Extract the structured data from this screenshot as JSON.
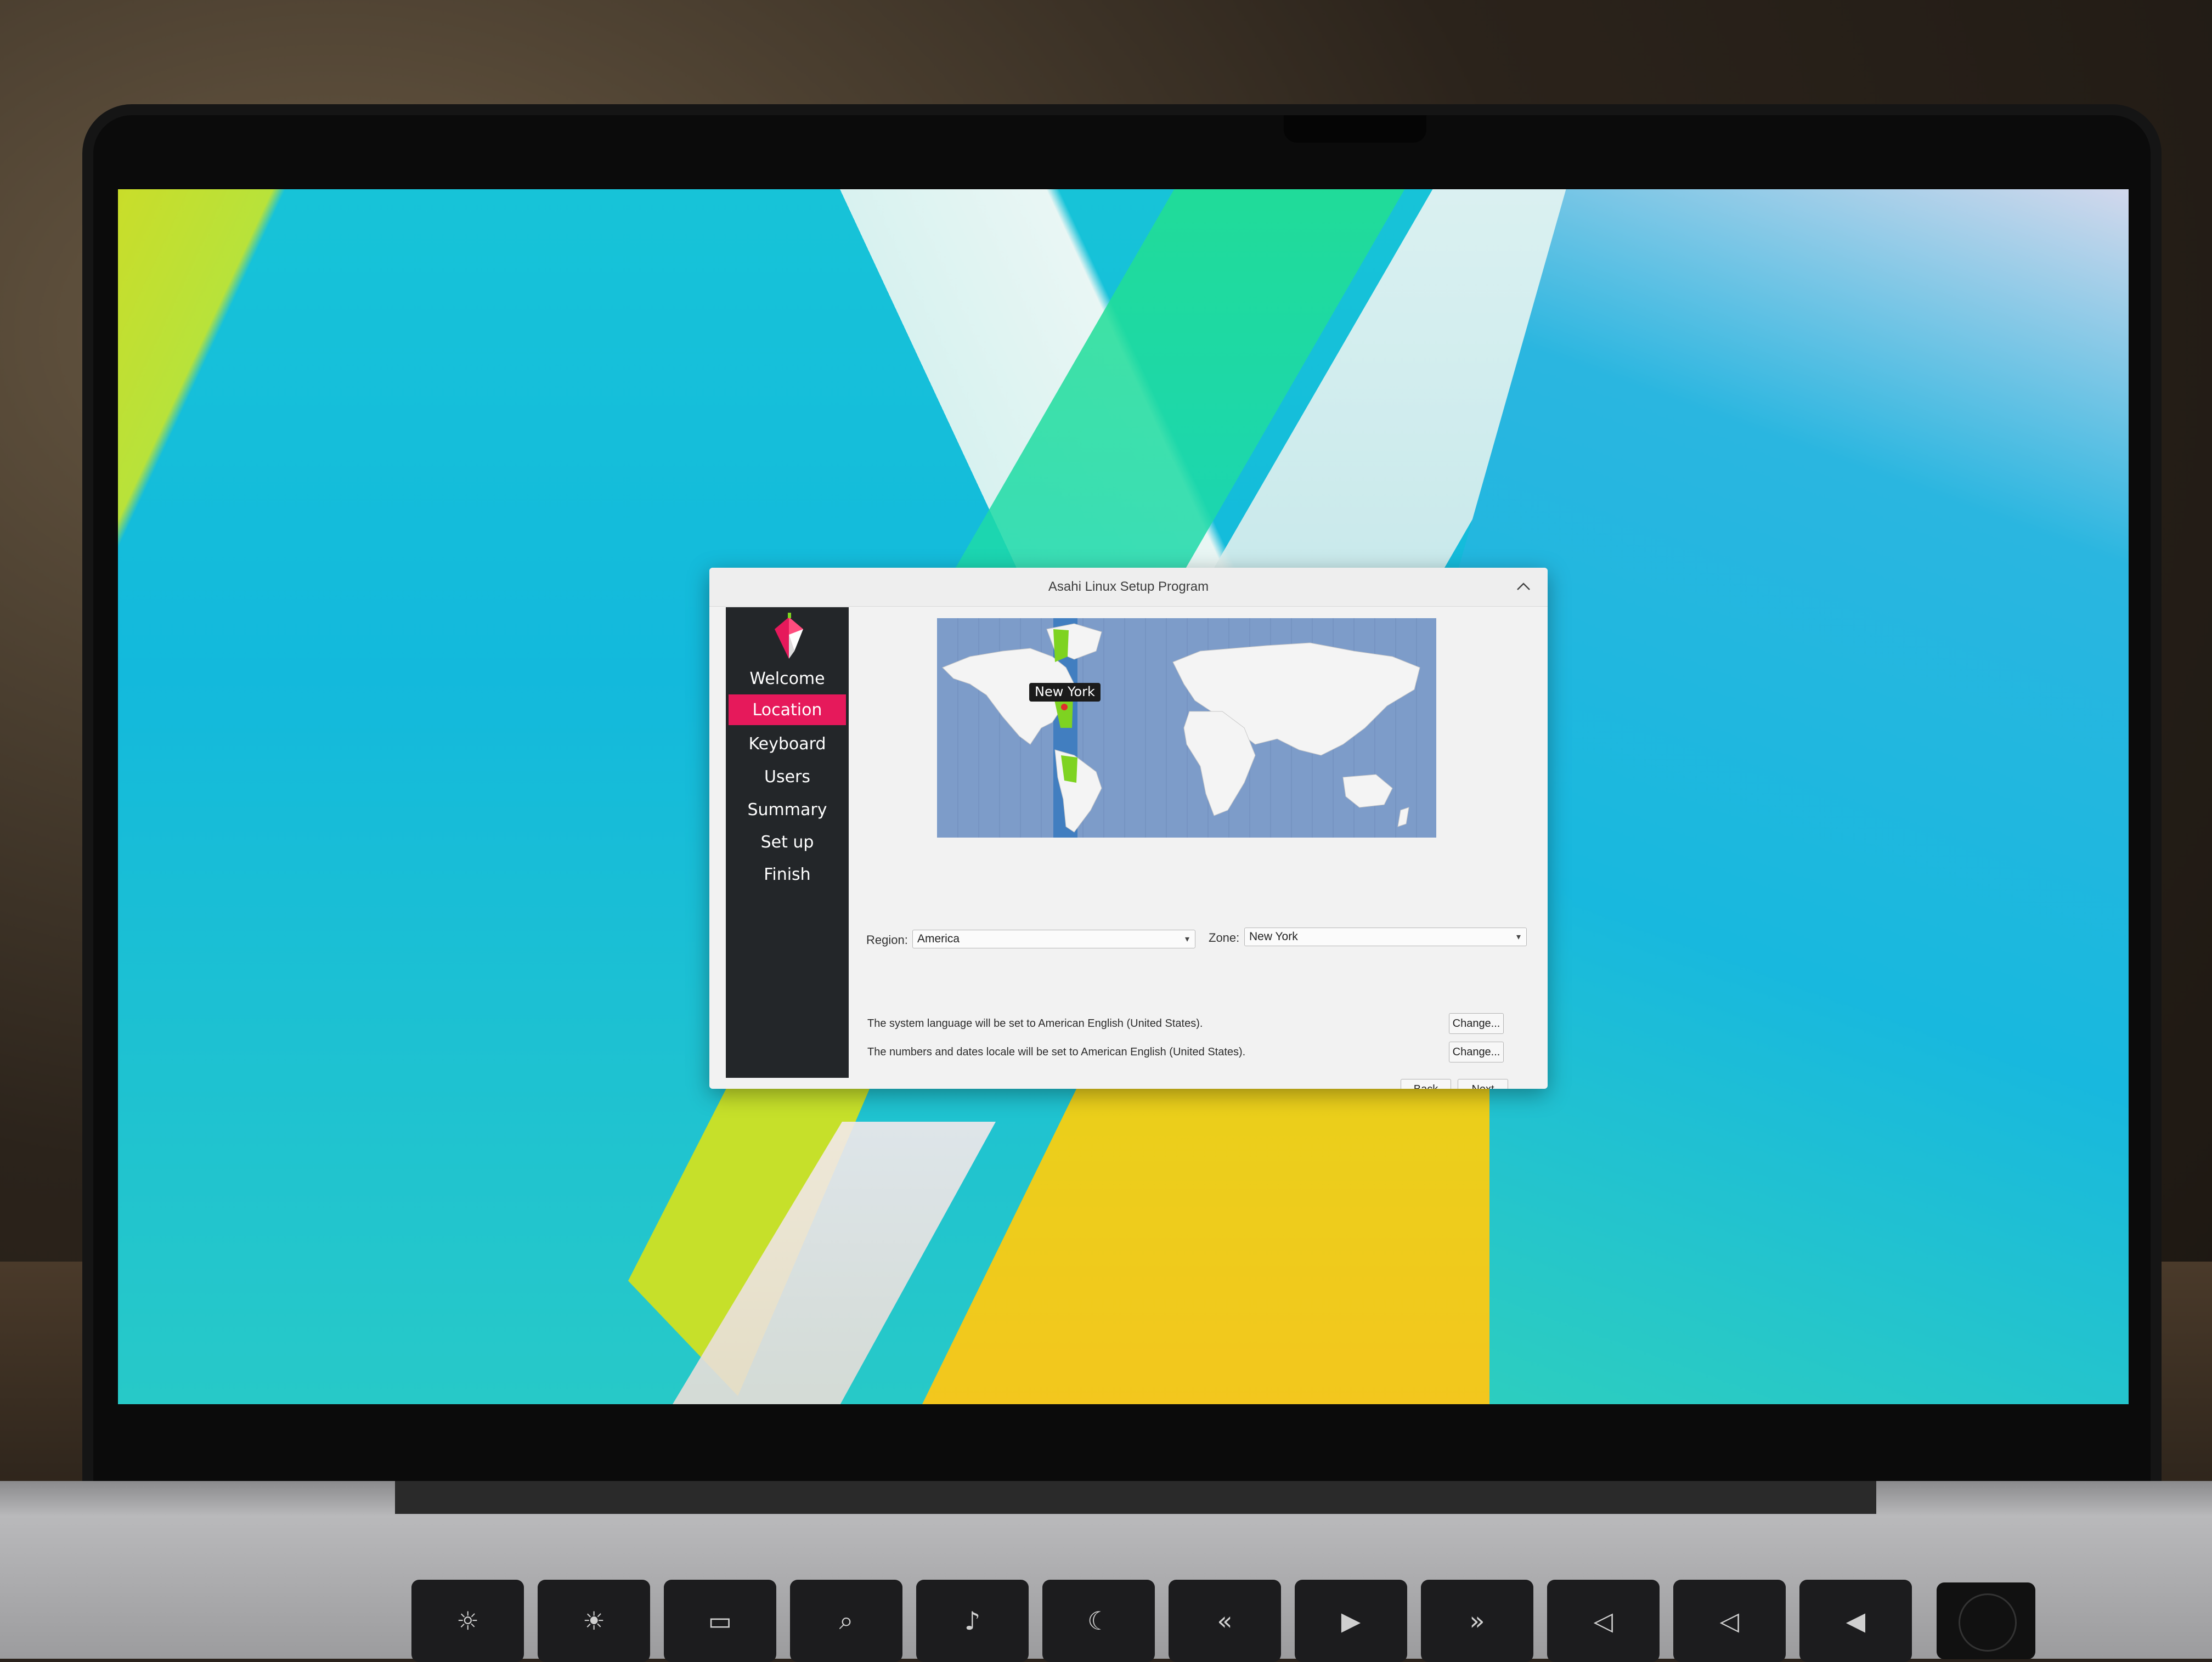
{
  "window": {
    "title": "Asahi Linux Setup Program",
    "collapse_icon": "chevron-up-icon"
  },
  "sidebar": {
    "items": [
      {
        "label": "Welcome",
        "active": false
      },
      {
        "label": "Location",
        "active": true
      },
      {
        "label": "Keyboard",
        "active": false
      },
      {
        "label": "Users",
        "active": false
      },
      {
        "label": "Summary",
        "active": false
      },
      {
        "label": "Set up",
        "active": false
      },
      {
        "label": "Finish",
        "active": false
      }
    ]
  },
  "map": {
    "city_label": "New York"
  },
  "location": {
    "region_label": "Region:",
    "region_value": "America",
    "zone_label": "Zone:",
    "zone_value": "New York"
  },
  "locale": {
    "language_text": "The system language will be set to American English (United States).",
    "language_change": "Change...",
    "numbers_text": "The numbers and dates locale will be set to American English (United States).",
    "numbers_change": "Change..."
  },
  "nav_buttons": {
    "back": "Back",
    "next": "Next"
  },
  "colors": {
    "sidebar_bg": "#232629",
    "active_item": "#e6195b",
    "map_ocean": "#7d9cc9",
    "map_land": "#f4f4f4",
    "timezone_band": "#3b7bbf",
    "timezone_highlight": "#7ed321"
  }
}
